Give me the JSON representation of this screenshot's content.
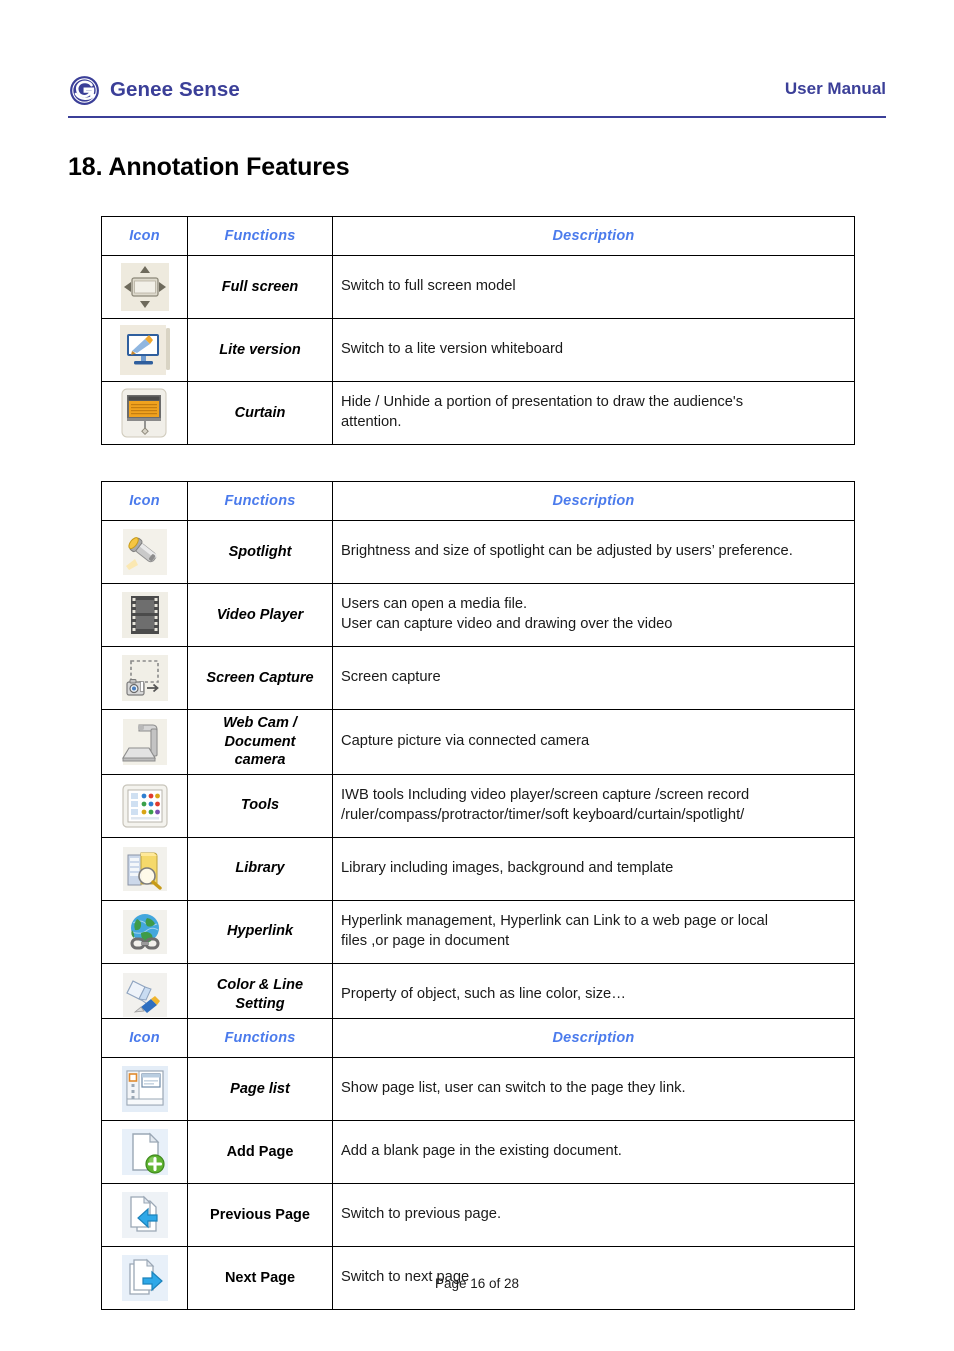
{
  "header": {
    "brand_name": "Genee Sense",
    "doc_type": "User Manual",
    "accent_color": "#3b3f98"
  },
  "title": "18. Annotation Features",
  "table_headers": {
    "icon": "Icon",
    "functions": "Functions",
    "description": "Description",
    "header_color": "#4b7bec"
  },
  "tables": [
    {
      "id": "table-view-modes",
      "rows": [
        {
          "icon": "full-screen-icon",
          "function": "Full screen",
          "function_style": "italic",
          "description_lines": [
            "Switch to full screen model"
          ]
        },
        {
          "icon": "lite-version-icon",
          "function": "Lite version",
          "function_style": "italic",
          "description_lines": [
            " Switch to a lite version whiteboard"
          ]
        },
        {
          "icon": "curtain-icon",
          "function": "Curtain",
          "function_style": "italic",
          "description_lines": [
            "Hide / Unhide a portion of presentation to draw the audience's",
            "attention."
          ]
        }
      ]
    },
    {
      "id": "table-tools",
      "rows": [
        {
          "icon": "spotlight-icon",
          "function": "Spotlight",
          "function_style": "italic",
          "description_lines": [
            "Brightness and size of spotlight can be adjusted by users’ preference."
          ]
        },
        {
          "icon": "video-player-icon",
          "function": "Video Player",
          "function_style": "italic",
          "description_lines": [
            "Users can open a media file.",
            "User can capture video and drawing over the video"
          ]
        },
        {
          "icon": "screen-capture-icon",
          "function": "Screen Capture",
          "function_style": "italic",
          "description_lines": [
            "Screen capture"
          ]
        },
        {
          "icon": "web-cam-icon",
          "function": "Web Cam /\nDocument\ncamera",
          "function_style": "italic",
          "description_lines": [
            "Capture picture via connected camera"
          ]
        },
        {
          "icon": "tools-icon",
          "function": "Tools",
          "function_style": "italic",
          "description_lines": [
            "IWB tools Including video player/screen capture /screen record",
            "/ruler/compass/protractor/timer/soft keyboard/curtain/spotlight/"
          ]
        },
        {
          "icon": "library-icon",
          "function": "Library",
          "function_style": "italic",
          "description_lines": [
            "Library including images, background and template"
          ]
        },
        {
          "icon": "hyperlink-icon",
          "function": "Hyperlink",
          "function_style": "italic",
          "description_lines": [
            "Hyperlink management, Hyperlink can Link to a web page or local",
            "files ,or page in document"
          ]
        },
        {
          "icon": "color-line-setting-icon",
          "function": "Color & Line\nSetting",
          "function_style": "italic",
          "description_lines": [
            "Property of object, such as line color, size…"
          ]
        }
      ]
    },
    {
      "id": "table-pages",
      "rows": [
        {
          "icon": "page-list-icon",
          "function": "Page list",
          "function_style": "italic",
          "description_lines": [
            "Show page list, user can switch to the page they link."
          ]
        },
        {
          "icon": "add-page-icon",
          "function": "Add Page",
          "function_style": "upright",
          "description_lines": [
            "Add a blank page in the existing document."
          ]
        },
        {
          "icon": "previous-page-icon",
          "function": "Previous Page",
          "function_style": "upright",
          "description_lines": [
            "Switch to previous page."
          ]
        },
        {
          "icon": "next-page-icon",
          "function": "Next Page",
          "function_style": "upright",
          "description_lines": [
            "Switch to next page"
          ]
        }
      ]
    }
  ],
  "footer": {
    "page_label": "Page 16 of 28"
  }
}
